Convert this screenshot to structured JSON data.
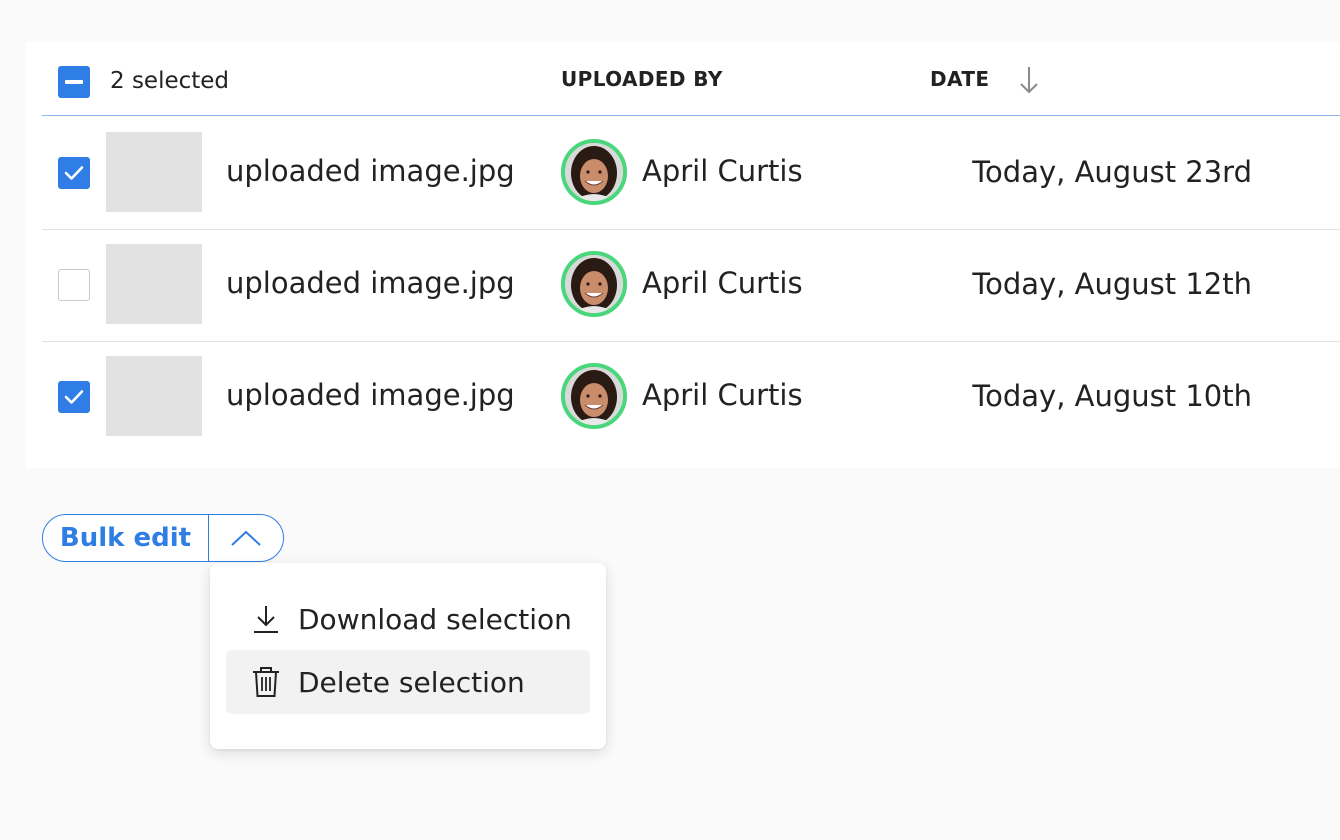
{
  "table": {
    "header": {
      "selected_count": "2 selected",
      "select_all_state": "indeterminate",
      "col_uploaded_by": "UPLOADED BY",
      "col_date": "DATE",
      "sort_icon": "arrow-down-icon"
    },
    "rows": [
      {
        "checked": true,
        "file_name": "uploaded image.jpg",
        "uploader": "April Curtis",
        "date": "Today, August 23rd"
      },
      {
        "checked": false,
        "file_name": "uploaded image.jpg",
        "uploader": "April Curtis",
        "date": "Today, August 12th"
      },
      {
        "checked": true,
        "file_name": "uploaded image.jpg",
        "uploader": "April Curtis",
        "date": "Today, August 10th"
      }
    ]
  },
  "bulk_edit": {
    "label": "Bulk edit",
    "toggle_icon": "chevron-up-icon"
  },
  "menu": {
    "items": [
      {
        "label": "Download selection",
        "icon": "download-icon"
      },
      {
        "label": "Delete selection",
        "icon": "trash-icon",
        "highlighted": true
      }
    ]
  },
  "colors": {
    "accent": "#2f7ee6",
    "avatar_ring": "#4ad67a",
    "header_divider": "#8fb8ee"
  }
}
